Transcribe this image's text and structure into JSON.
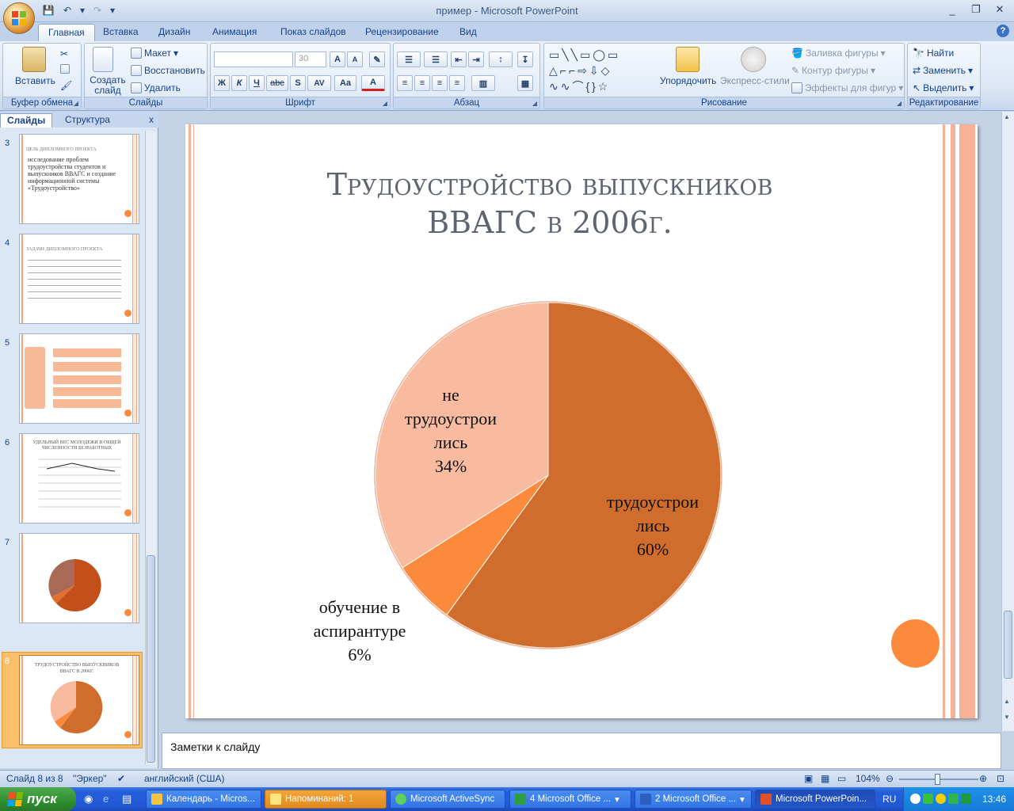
{
  "window": {
    "title": "пример - Microsoft PowerPoint",
    "controls": [
      "_",
      "❐",
      "✕"
    ]
  },
  "qat": [
    "💾",
    "↶",
    "▾",
    "↷",
    "▾"
  ],
  "ribbon_tabs": [
    "Главная",
    "Вставка",
    "Дизайн",
    "Анимация",
    "Показ слайдов",
    "Рецензирование",
    "Вид"
  ],
  "ribbon": {
    "clipboard": {
      "paste": "Вставить",
      "label": "Буфер обмена"
    },
    "slides": {
      "new_slide": "Создать слайд",
      "layout": "Макет",
      "reset": "Восстановить",
      "delete": "Удалить",
      "label": "Слайды"
    },
    "font": {
      "font_name": "",
      "font_size": "30",
      "label": "Шрифт",
      "bold": "Ж",
      "italic": "К",
      "underline": "Ч",
      "strike": "abc",
      "shadow": "S",
      "spacing": "AV",
      "case": "Aa",
      "color": "A"
    },
    "paragraph": {
      "label": "Абзац"
    },
    "drawing": {
      "arrange": "Упорядочить",
      "quick_styles": "Экспресс-стили",
      "fill": "Заливка фигуры",
      "outline": "Контур фигуры",
      "effects": "Эффекты для фигур",
      "label": "Рисование"
    },
    "editing": {
      "find": "Найти",
      "replace": "Заменить",
      "select": "Выделить",
      "label": "Редактирование"
    }
  },
  "pane": {
    "tabs": [
      "Слайды",
      "Структура"
    ],
    "close": "x",
    "thumbs": [
      {
        "num": "3",
        "title": "ЦЕЛЬ ДИПЛОМНОГО ПРОЕКТА",
        "text": "исследование проблем трудоустройства студентов и выпускников ВВАГС и создание информационной системы «Трудоустройство»"
      },
      {
        "num": "4",
        "title": "ЗАДАЧИ ДИПЛОМНОГО ПРОЕКТА"
      },
      {
        "num": "5"
      },
      {
        "num": "6",
        "title": "УДЕЛЬНЫЙ ВЕС МОЛОДЕЖИ В ОБЩЕЙ ЧИСЛЕННОСТИ БЕЗРАБОТНЫХ"
      },
      {
        "num": "7"
      },
      {
        "num": "8",
        "title": "ТРУДОУСТРОЙСТВО ВЫПУСКНИКОВ ВВАГС В 2006Г."
      }
    ]
  },
  "slide": {
    "title_line1": "Трудоустройство выпускников",
    "title_line2": "ВВАГС в 2006г.",
    "labels": {
      "employed": [
        "трудоустрои",
        "лись",
        "60%"
      ],
      "not_employed": [
        "не",
        "трудоустрои",
        "лись",
        "34%"
      ],
      "grad_school": [
        "обучение в",
        "аспирантуре",
        "6%"
      ]
    }
  },
  "chart_data": {
    "type": "pie",
    "title": "Трудоустройство выпускников ВВАГС в 2006г.",
    "categories": [
      "трудоустроились",
      "обучение в аспирантуре",
      "не трудоустроились"
    ],
    "values": [
      60,
      6,
      34
    ],
    "colors": [
      "#d06d2c",
      "#fb8a3c",
      "#f8bba0"
    ]
  },
  "notes": {
    "placeholder": "Заметки к слайду"
  },
  "status": {
    "slide_of": "Слайд 8 из 8",
    "theme": "\"Эркер\"",
    "language": "английский (США)",
    "zoom": "104%",
    "zoom_fraction": 0.5
  },
  "taskbar": {
    "start": "пуск",
    "buttons": [
      "Календарь - Micros...",
      "Напоминаний: 1",
      "Microsoft ActiveSync",
      "4 Microsoft Office ...",
      "2 Microsoft Office ...",
      "Microsoft PowerPoin..."
    ],
    "lang": "RU",
    "clock": "13:46"
  },
  "colors": {
    "accent": "#fb8a3c",
    "slice_dark": "#d06d2c",
    "slice_light": "#f8bba0",
    "stripe": "#f6b196"
  }
}
